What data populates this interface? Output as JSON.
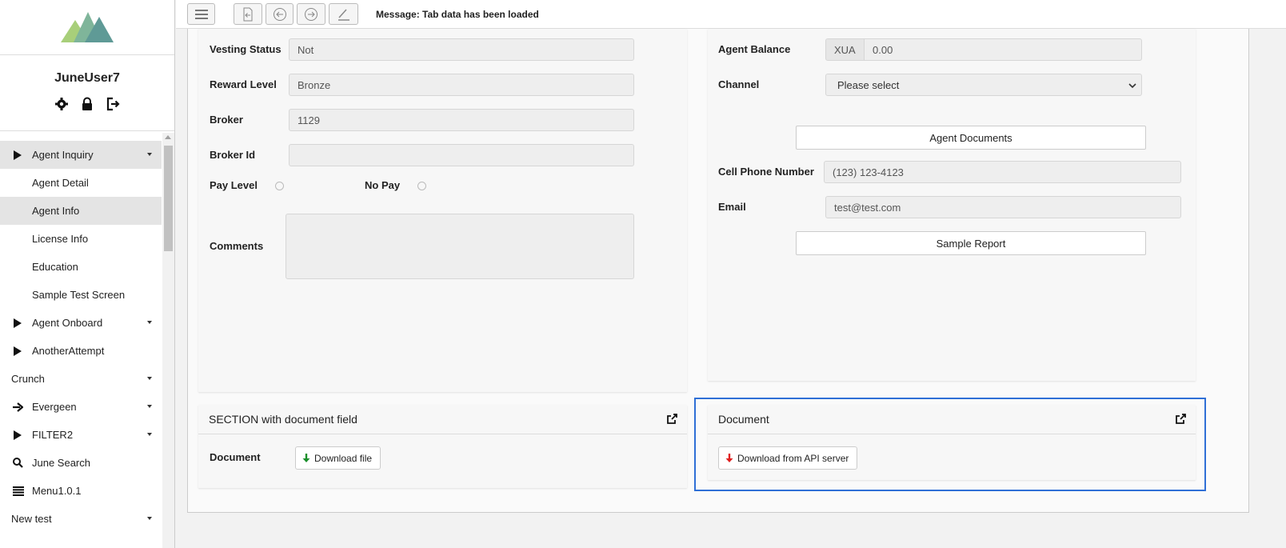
{
  "user": {
    "name": "JuneUser7"
  },
  "sidebar": {
    "items": [
      {
        "label": "Agent Inquiry",
        "icon": "play-icon",
        "type": "top",
        "caret": true,
        "active": true
      },
      {
        "label": "Agent Detail",
        "type": "sub"
      },
      {
        "label": "Agent Info",
        "type": "sub",
        "active": true
      },
      {
        "label": "License Info",
        "type": "sub"
      },
      {
        "label": "Education",
        "type": "sub"
      },
      {
        "label": "Sample Test Screen",
        "type": "sub"
      },
      {
        "label": "Agent Onboard",
        "icon": "play-icon",
        "type": "top",
        "caret": true
      },
      {
        "label": "AnotherAttempt",
        "icon": "play-icon",
        "type": "top"
      },
      {
        "label": "Crunch",
        "type": "plain",
        "caret": true
      },
      {
        "label": "Evergeen",
        "icon": "arrow-right-icon",
        "type": "top",
        "caret": true
      },
      {
        "label": "FILTER2",
        "icon": "play-icon",
        "type": "top",
        "caret": true
      },
      {
        "label": "June Search",
        "icon": "search-icon",
        "type": "top"
      },
      {
        "label": "Menu1.0.1",
        "icon": "list-icon",
        "type": "top"
      },
      {
        "label": "New test",
        "type": "plain",
        "caret": true
      }
    ]
  },
  "toolbar": {
    "message": "Message: Tab data has been loaded"
  },
  "left_form": {
    "vesting_status_label": "Vesting Status",
    "vesting_status_value": "Not",
    "reward_level_label": "Reward Level",
    "reward_level_value": "Bronze",
    "broker_label": "Broker",
    "broker_value": "1129",
    "broker_id_label": "Broker Id",
    "broker_id_value": "",
    "pay_level_label": "Pay Level",
    "no_pay_label": "No Pay",
    "comments_label": "Comments",
    "comments_value": ""
  },
  "right_form": {
    "agent_balance_label": "Agent Balance",
    "currency": "XUA",
    "agent_balance_value": "0.00",
    "channel_label": "Channel",
    "channel_value": "Please select",
    "agent_documents_button": "Agent Documents",
    "cell_phone_label": "Cell Phone Number",
    "cell_phone_value": "(123) 123-4123",
    "email_label": "Email",
    "email_value": "test@test.com",
    "sample_report_button": "Sample Report"
  },
  "doc_section": {
    "title": "SECTION with document field",
    "field_label": "Document",
    "button_label": "Download file"
  },
  "api_section": {
    "title": "Document",
    "button_label": "Download from API server"
  },
  "colors": {
    "accent_focus": "#2f6fd6",
    "download_green": "#1a8f2a",
    "download_red": "#e02020",
    "logo_green": "#a8cf7a",
    "logo_teal": "#5f9a96"
  }
}
